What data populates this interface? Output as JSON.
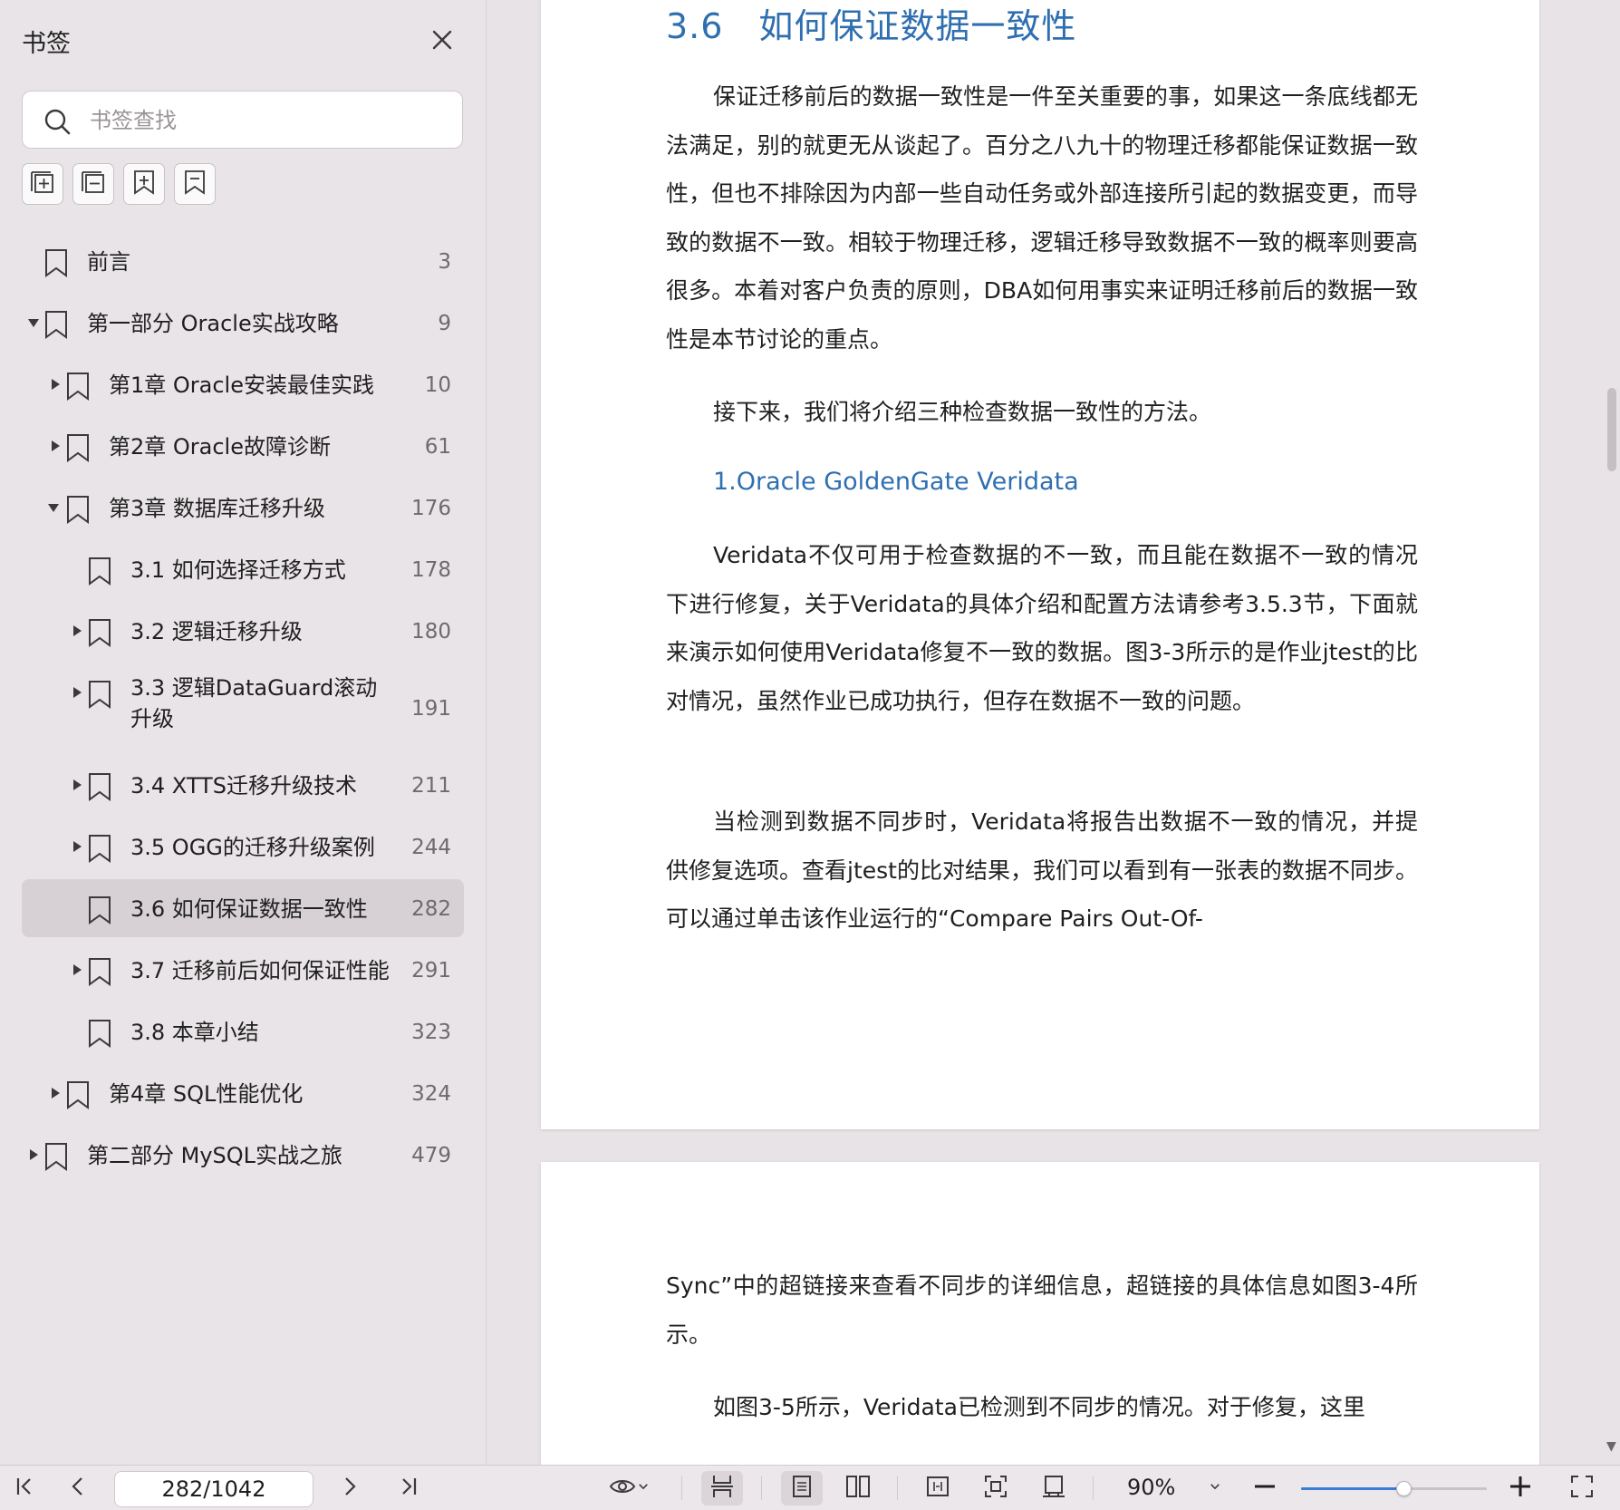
{
  "sidebar": {
    "title": "书签",
    "close_icon": "close-icon",
    "search_placeholder": "书签查找",
    "tools": [
      "expand-all-icon",
      "collapse-all-icon",
      "add-bookmark-icon",
      "bookmark-icon"
    ],
    "items": [
      {
        "label": "前言",
        "page": "3",
        "level": 0,
        "arrow": "none"
      },
      {
        "label": "第一部分 Oracle实战攻略",
        "page": "9",
        "level": 0,
        "arrow": "down"
      },
      {
        "label": "第1章 Oracle安装最佳实践",
        "page": "10",
        "level": 1,
        "arrow": "right"
      },
      {
        "label": "第2章 Oracle故障诊断",
        "page": "61",
        "level": 1,
        "arrow": "right"
      },
      {
        "label": "第3章 数据库迁移升级",
        "page": "176",
        "level": 1,
        "arrow": "down"
      },
      {
        "label": "3.1 如何选择迁移方式",
        "page": "178",
        "level": 2,
        "arrow": "none"
      },
      {
        "label": "3.2 逻辑迁移升级",
        "page": "180",
        "level": 2,
        "arrow": "right"
      },
      {
        "label": "3.3 逻辑DataGuard滚动升级",
        "page": "191",
        "level": 2,
        "arrow": "right"
      },
      {
        "label": "3.4 XTTS迁移升级技术",
        "page": "211",
        "level": 2,
        "arrow": "right"
      },
      {
        "label": "3.5 OGG的迁移升级案例",
        "page": "244",
        "level": 2,
        "arrow": "right"
      },
      {
        "label": "3.6 如何保证数据一致性",
        "page": "282",
        "level": 2,
        "arrow": "none",
        "selected": true
      },
      {
        "label": "3.7 迁移前后如何保证性能",
        "page": "291",
        "level": 2,
        "arrow": "right"
      },
      {
        "label": "3.8 本章小结",
        "page": "323",
        "level": 2,
        "arrow": "none"
      },
      {
        "label": "第4章 SQL性能优化",
        "page": "324",
        "level": 1,
        "arrow": "right"
      },
      {
        "label": "第二部分 MySQL实战之旅",
        "page": "479",
        "level": 0,
        "arrow": "right"
      }
    ]
  },
  "document": {
    "heading": "3.6　如何保证数据一致性",
    "para1": "保证迁移前后的数据一致性是一件至关重要的事，如果这一条底线都无法满足，别的就更无从谈起了。百分之八九十的物理迁移都能保证数据一致性，但也不排除因为内部一些自动任务或外部连接所引起的数据变更，而导致的数据不一致。相较于物理迁移，逻辑迁移导致数据不一致的概率则要高很多。本着对客户负责的原则，DBA如何用事实来证明迁移前后的数据一致性是本节讨论的重点。",
    "para2": "接下来，我们将介绍三种检查数据一致性的方法。",
    "subheading": "1.Oracle GoldenGate Veridata",
    "para3": "Veridata不仅可用于检查数据的不一致，而且能在数据不一致的情况下进行修复，关于Veridata的具体介绍和配置方法请参考3.5.3节，下面就来演示如何使用Veridata修复不一致的数据。图3-3所示的是作业jtest的比对情况，虽然作业已成功执行，但存在数据不一致的问题。",
    "para4": "当检测到数据不同步时，Veridata将报告出数据不一致的情况，并提供修复选项。查看jtest的比对结果，我们可以看到有一张表的数据不同步。可以通过单击该作业运行的“Compare Pairs Out-Of-",
    "page2_para1": "Sync”中的超链接来查看不同步的详细信息，超链接的具体信息如图3-4所示。",
    "page2_para2": "如图3-5所示，Veridata已检测到不同步的情况。对于修复，这里"
  },
  "toolbar": {
    "page_value": "282/1042",
    "zoom": "90%",
    "zoom_level": 0.55,
    "accent": "#3a7bd5"
  }
}
